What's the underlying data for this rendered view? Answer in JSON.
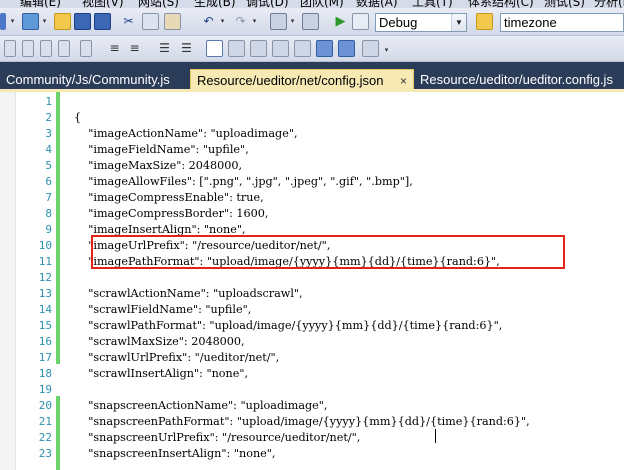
{
  "menu": {
    "items": [
      "编辑(E)",
      "视图(V)",
      "网站(S)",
      "生成(B)",
      "调试(D)",
      "团队(M)",
      "数据(A)",
      "工具(T)",
      "体系结构(C)",
      "测试(S)",
      "分析(N)"
    ]
  },
  "toolbar": {
    "solution_config": "Debug",
    "find_text": "timezone"
  },
  "tabs": [
    {
      "label": "Community/Js/Community.js"
    },
    {
      "label": "Resource/ueditor/net/config.json",
      "close": "×"
    },
    {
      "label": "Resource/ueditor/ueditor.config.js"
    }
  ],
  "editor": {
    "lines": [
      {
        "n": "1",
        "text": ""
      },
      {
        "n": "2",
        "text": "{"
      },
      {
        "n": "3",
        "text": "    \"imageActionName\": \"uploadimage\","
      },
      {
        "n": "4",
        "text": "    \"imageFieldName\": \"upfile\","
      },
      {
        "n": "5",
        "text": "    \"imageMaxSize\": 2048000,"
      },
      {
        "n": "6",
        "text": "    \"imageAllowFiles\": [\".png\", \".jpg\", \".jpeg\", \".gif\", \".bmp\"],"
      },
      {
        "n": "7",
        "text": "    \"imageCompressEnable\": true,"
      },
      {
        "n": "8",
        "text": "    \"imageCompressBorder\": 1600,"
      },
      {
        "n": "9",
        "text": "    \"imageInsertAlign\": \"none\","
      },
      {
        "n": "10",
        "text": "    \"imageUrlPrefix\": \"/resource/ueditor/net/\","
      },
      {
        "n": "11",
        "text": "    \"imagePathFormat\": \"upload/image/{yyyy}{mm}{dd}/{time}{rand:6}\","
      },
      {
        "n": "12",
        "text": ""
      },
      {
        "n": "13",
        "text": "    \"scrawlActionName\": \"uploadscrawl\","
      },
      {
        "n": "14",
        "text": "    \"scrawlFieldName\": \"upfile\","
      },
      {
        "n": "15",
        "text": "    \"scrawlPathFormat\": \"upload/image/{yyyy}{mm}{dd}/{time}{rand:6}\","
      },
      {
        "n": "16",
        "text": "    \"scrawlMaxSize\": 2048000,"
      },
      {
        "n": "17",
        "text": "    \"scrawlUrlPrefix\": \"/ueditor/net/\","
      },
      {
        "n": "18",
        "text": "    \"scrawlInsertAlign\": \"none\","
      },
      {
        "n": "19",
        "text": ""
      },
      {
        "n": "20",
        "text": "    \"snapscreenActionName\": \"uploadimage\","
      },
      {
        "n": "21",
        "text": "    \"snapscreenPathFormat\": \"upload/image/{yyyy}{mm}{dd}/{time}{rand:6}\","
      },
      {
        "n": "22",
        "text": "    \"snapscreenUrlPrefix\": \"/resource/ueditor/net/\","
      },
      {
        "n": "23",
        "text": "    \"snapscreenInsertAlign\": \"none\","
      }
    ]
  },
  "icons": [
    "new-file-icon",
    "add-item-icon",
    "open-icon",
    "save-icon",
    "save-all-icon",
    "cut-icon",
    "copy-icon",
    "paste-icon",
    "undo-icon",
    "redo-icon",
    "navigate-icon",
    "start-debug-icon",
    "find-icon",
    "indent-icon",
    "comment-icon",
    "bookmark-icon"
  ],
  "colors": {
    "line_number": "#2b91af",
    "tab_strip": "#2b3c59",
    "active_tab": "#f6e9b4",
    "change_mark": "#6cd36c",
    "highlight_box": "#e0231b"
  }
}
